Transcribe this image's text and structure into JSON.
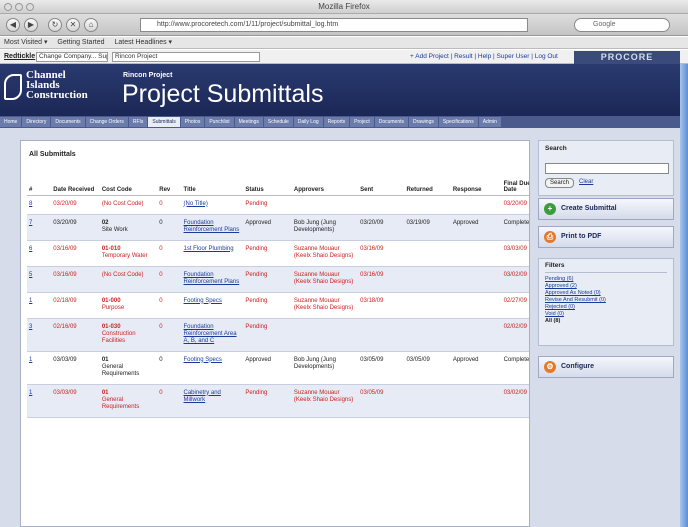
{
  "window": {
    "title": "Mozilla Firefox"
  },
  "browser": {
    "url": "http://www.procoretech.com/1/11/project/submittal_log.htm",
    "search_placeholder": "Google",
    "bookmarks": [
      "Most Visited ▾",
      "Getting Started",
      "Latest Headlines ▾"
    ]
  },
  "toolbar": {
    "label": "Redtickle",
    "company": "Change Company... Superuser",
    "project": "Rincon Project",
    "links": "+ Add Project | Result | Help | Super User | Log Out",
    "brand": "PROCORE"
  },
  "header": {
    "logo_text": [
      "Channel",
      "Islands",
      "Construction"
    ],
    "project_name": "Rincon Project",
    "page_title": "Project Submittals"
  },
  "tabs": [
    "Home",
    "Directory",
    "Documents",
    "Change Orders",
    "RFIs",
    "Submittals",
    "Photos",
    "Punchlist",
    "Meetings",
    "Schedule",
    "Daily Log",
    "Reports",
    "Project",
    "Documents",
    "Drawings",
    "Specifications",
    "Admin"
  ],
  "active_tab": 5,
  "panel": {
    "title": "All Submittals"
  },
  "columns": [
    "#",
    "Date Received",
    "Cost Code",
    "Rev",
    "Title",
    "Status",
    "Approvers",
    "Sent",
    "Returned",
    "Response",
    "Final Due Date"
  ],
  "rows": [
    {
      "num": "8",
      "date": "03/20/09",
      "code": "(No Cost Code)",
      "code2": "",
      "rev": "0",
      "title": "(No Title)",
      "status": "Pending",
      "approvers": "",
      "sent": "",
      "returned": "",
      "response": "",
      "final": "03/20/09",
      "late": true
    },
    {
      "num": "7",
      "date": "03/20/09",
      "code": "02",
      "code2": "Site Work",
      "rev": "0",
      "title": "Foundation Reinforcement Plans",
      "status": "Approved",
      "approvers": "Bob Jung (Jung Developments)",
      "sent": "03/20/09",
      "returned": "03/19/09",
      "response": "Approved",
      "final": "Complete",
      "late": false
    },
    {
      "num": "6",
      "date": "03/16/09",
      "code": "01-010",
      "code2": "Temporary Water",
      "rev": "0",
      "title": "1st Floor Plumbing",
      "status": "Pending",
      "approvers": "Suzanne Mouaur (Keelx Shaio Designs)",
      "sent": "03/16/09",
      "returned": "",
      "response": "",
      "final": "03/03/09",
      "late": true
    },
    {
      "num": "5",
      "date": "03/16/09",
      "code": "(No Cost Code)",
      "code2": "",
      "rev": "0",
      "title": "Foundation Reinforcement Plans",
      "status": "Pending",
      "approvers": "Suzanne Mouaur (Keelx Shaio Designs)",
      "sent": "03/16/09",
      "returned": "",
      "response": "",
      "final": "03/02/09",
      "late": true
    },
    {
      "num": "1",
      "date": "02/18/09",
      "code": "01-000",
      "code2": "Purpose",
      "rev": "0",
      "title": "Footing Specs",
      "status": "Pending",
      "approvers": "Suzanne Mouaur (Keelx Shaio Designs)",
      "sent": "03/18/09",
      "returned": "",
      "response": "",
      "final": "02/27/09",
      "late": true
    },
    {
      "num": "3",
      "date": "02/16/09",
      "code": "01-030",
      "code2": "Construction Facilities",
      "rev": "0",
      "title": "Foundation Reinforcement Area A, B, and C",
      "status": "Pending",
      "approvers": "",
      "sent": "",
      "returned": "",
      "response": "",
      "final": "02/02/09",
      "late": true
    },
    {
      "num": "1",
      "date": "03/03/09",
      "code": "01",
      "code2": "General Requirements",
      "rev": "0",
      "title": "Footing Specs",
      "status": "Approved",
      "approvers": "Bob Jung (Jung Developments)",
      "sent": "03/05/09",
      "returned": "03/05/09",
      "response": "Approved",
      "final": "Complete",
      "late": false
    },
    {
      "num": "1",
      "date": "03/03/09",
      "code": "01",
      "code2": "General Requirements",
      "rev": "0",
      "title": "Cabinetry and Millwork",
      "status": "Pending",
      "approvers": "Suzanne Mouaur (Keelx Shaio Designs)",
      "sent": "03/05/09",
      "returned": "",
      "response": "",
      "final": "03/02/09",
      "late": true
    }
  ],
  "sidebar": {
    "search_label": "Search",
    "search_button": "Search",
    "clear_link": "Clear",
    "create_button": "Create Submittal",
    "print_button": "Print to PDF",
    "filters_title": "Filters",
    "filters": [
      "Pending (6)",
      "Approved (2)",
      "Approved As Noted (0)",
      "Revise And Resubmit (0)",
      "Rejected (0)",
      "Void (0)"
    ],
    "all_filter": "All (8)",
    "configure_button": "Configure"
  }
}
